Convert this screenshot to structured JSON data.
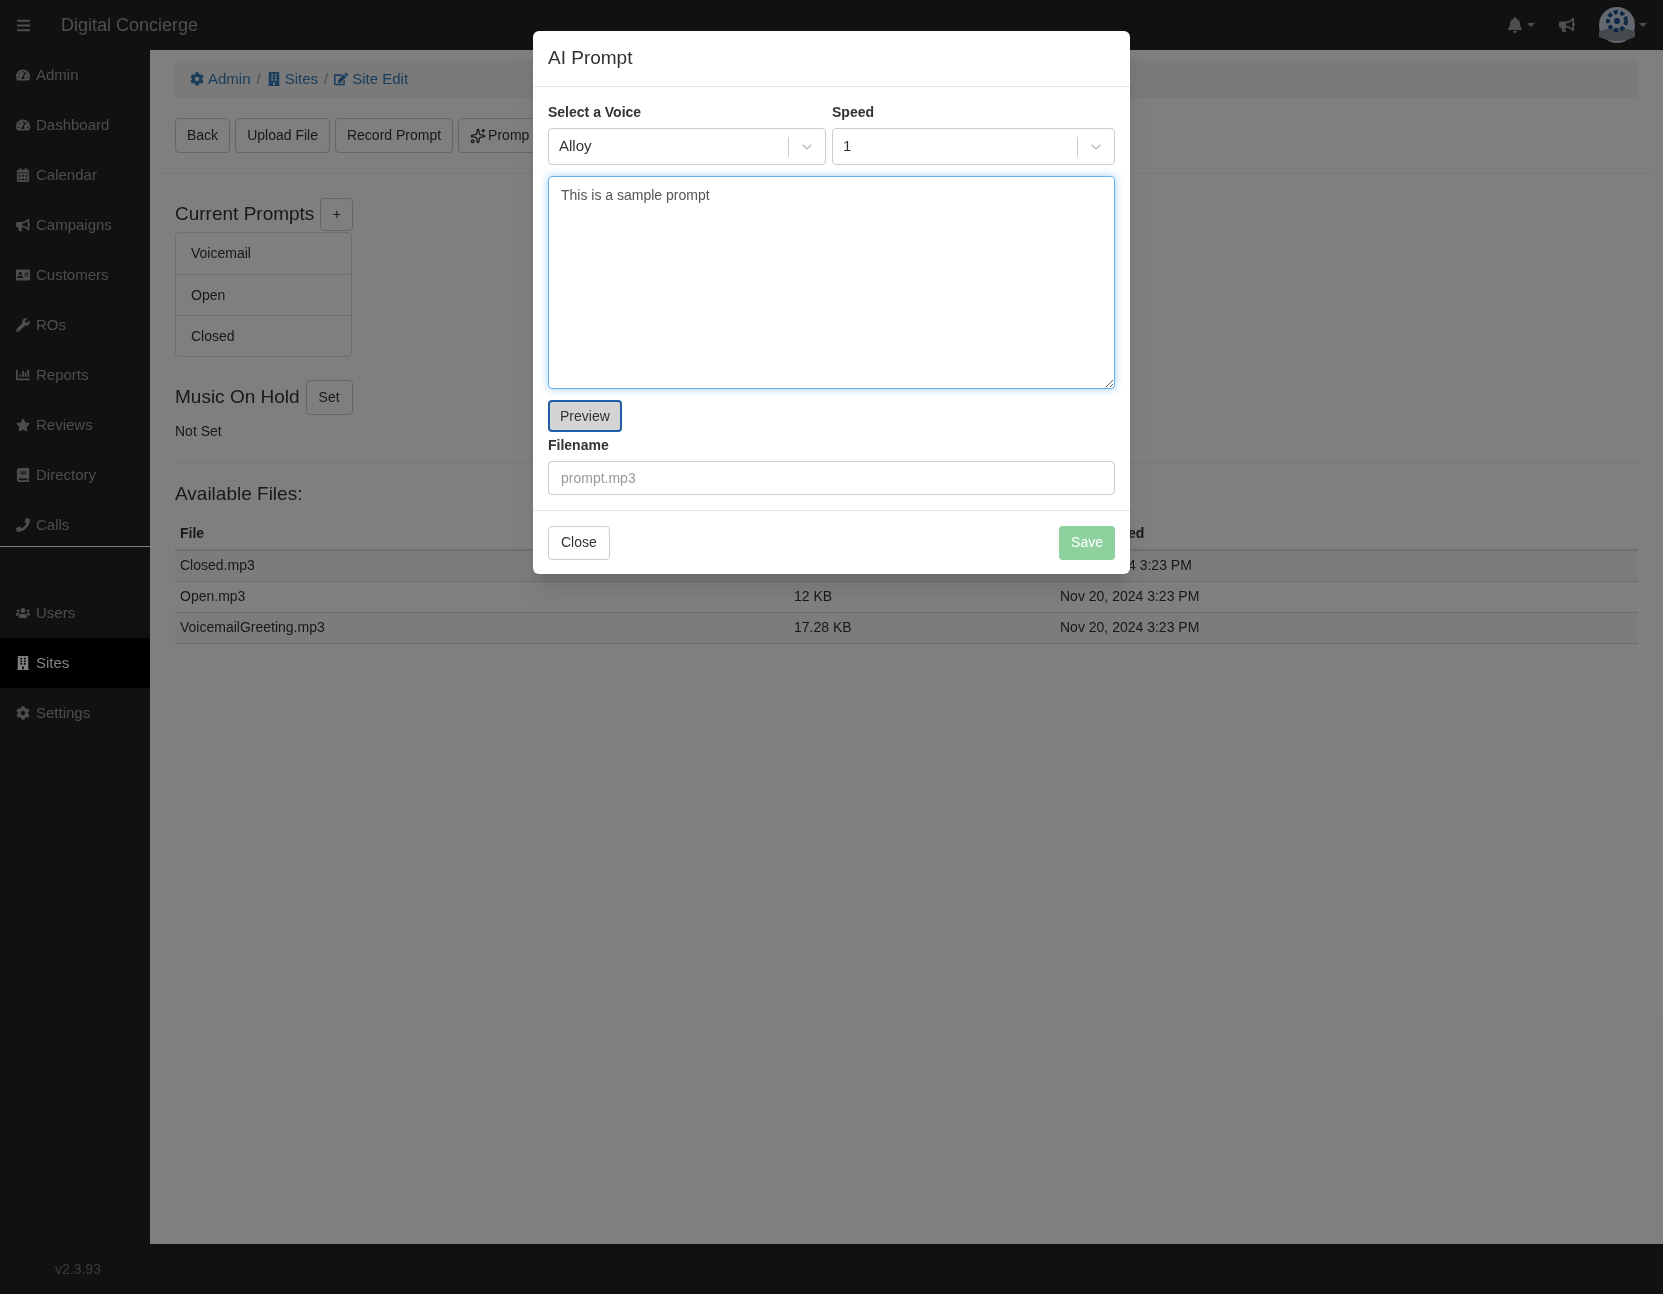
{
  "app": {
    "title": "Digital Concierge",
    "version": "v2.3.93"
  },
  "sidebar": {
    "sections": [
      {
        "items": [
          {
            "label": "Admin",
            "selected": false
          },
          {
            "label": "Dashboard",
            "selected": false
          },
          {
            "label": "Calendar",
            "selected": false
          },
          {
            "label": "Campaigns",
            "selected": false
          },
          {
            "label": "Customers",
            "selected": false
          },
          {
            "label": "ROs",
            "selected": false
          },
          {
            "label": "Reports",
            "selected": false
          },
          {
            "label": "Reviews",
            "selected": false
          },
          {
            "label": "Directory",
            "selected": false
          },
          {
            "label": "Calls",
            "selected": false
          }
        ]
      },
      {
        "items": [
          {
            "label": "Users",
            "selected": false
          },
          {
            "label": "Sites",
            "selected": true
          },
          {
            "label": "Settings",
            "selected": false
          }
        ]
      }
    ]
  },
  "breadcrumb": [
    {
      "kind": "link",
      "text": "Admin"
    },
    {
      "kind": "separator",
      "text": "/"
    },
    {
      "kind": "link",
      "text": "Sites"
    },
    {
      "kind": "separator",
      "text": "/"
    },
    {
      "kind": "link",
      "text": "Site Edit"
    }
  ],
  "toolbar": [
    "Back",
    "Upload File",
    "Record Prompt",
    "Promp"
  ],
  "current_prompts": {
    "title": "Current Prompts",
    "add_button": "+",
    "items": [
      "Voicemail",
      "Open",
      "Closed"
    ]
  },
  "music_on_hold": {
    "title": "Music On Hold",
    "button": "Set",
    "value": "Not Set"
  },
  "available_files": {
    "title": "Available Files:",
    "columns": [
      {
        "text": "File",
        "clipped": false
      },
      {
        "text": ""
      },
      {
        "text": "ed",
        "clipped": true
      }
    ],
    "rows": [
      [
        {
          "text": "Closed.mp3",
          "clipped": false
        },
        {
          "text": ""
        },
        {
          "text": "4 3:23 PM",
          "clipped": true
        }
      ],
      [
        {
          "text": "Open.mp3",
          "clipped": false
        },
        {
          "text": "12 KB",
          "clipped": false
        },
        {
          "text": "Nov 20, 2024 3:23 PM",
          "clipped": false
        }
      ],
      [
        {
          "text": "VoicemailGreeting.mp3",
          "clipped": false
        },
        {
          "text": "17.28 KB",
          "clipped": false
        },
        {
          "text": "Nov 20, 2024 3:23 PM",
          "clipped": false
        }
      ]
    ]
  },
  "dialog": {
    "title": "AI Prompt",
    "voice": {
      "label": "Select a Voice",
      "value": "Alloy"
    },
    "speed": {
      "label": "Speed",
      "value": "1"
    },
    "prompt_text": "This is a sample prompt",
    "preview_button": "Preview",
    "filename": {
      "label": "Filename",
      "placeholder": "prompt.mp3"
    },
    "close_button": "Close",
    "save_button": {
      "label": "Save",
      "disabled": true
    }
  }
}
